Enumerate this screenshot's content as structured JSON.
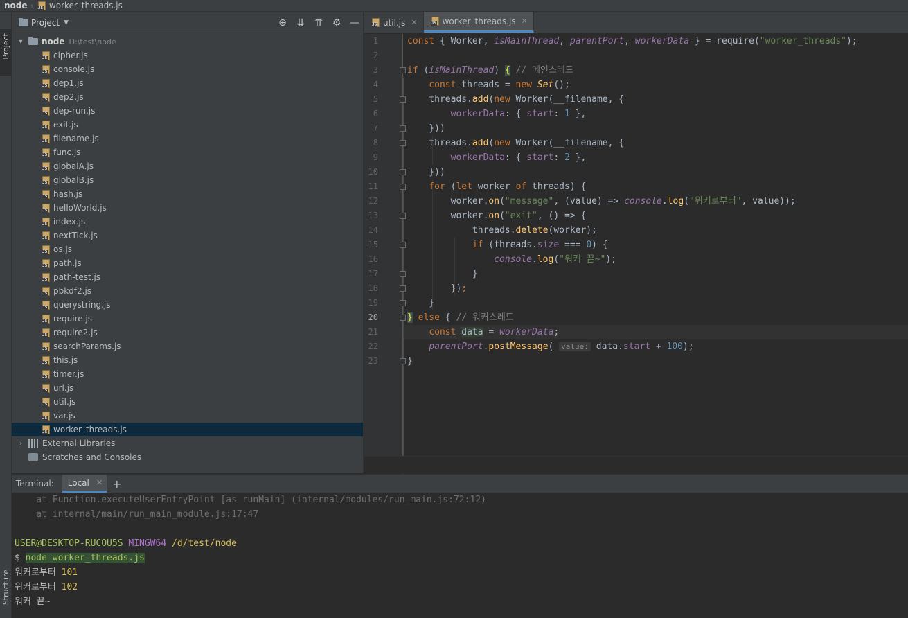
{
  "navbar": {
    "root": "node",
    "file": "worker_threads.js"
  },
  "left_stripe": {
    "project_label": "Project",
    "structure_label": "Structure"
  },
  "project_panel": {
    "title": "Project",
    "root": {
      "name": "node",
      "path": "D:\\test\\node"
    },
    "files": [
      "cipher.js",
      "console.js",
      "dep1.js",
      "dep2.js",
      "dep-run.js",
      "exit.js",
      "filename.js",
      "func.js",
      "globalA.js",
      "globalB.js",
      "hash.js",
      "helloWorld.js",
      "index.js",
      "nextTick.js",
      "os.js",
      "path.js",
      "path-test.js",
      "pbkdf2.js",
      "querystring.js",
      "require.js",
      "require2.js",
      "searchParams.js",
      "this.js",
      "timer.js",
      "url.js",
      "util.js",
      "var.js",
      "worker_threads.js"
    ],
    "selected_file": "worker_threads.js",
    "external_libraries": "External Libraries",
    "scratches": "Scratches and Consoles",
    "icons": [
      "locate-icon",
      "expand-all-icon",
      "collapse-all-icon",
      "gear-icon",
      "hide-icon"
    ]
  },
  "editor": {
    "tabs": [
      {
        "label": "util.js",
        "active": false
      },
      {
        "label": "worker_threads.js",
        "active": true
      }
    ],
    "caret_line": 20,
    "line_numbers": [
      "1",
      "2",
      "3",
      "4",
      "5",
      "6",
      "7",
      "8",
      "9",
      "10",
      "11",
      "12",
      "13",
      "14",
      "15",
      "16",
      "17",
      "18",
      "19",
      "20",
      "21",
      "22",
      "23"
    ],
    "strings": {
      "require_module": "\"worker_threads\"",
      "comment_main": "// 메인스레드",
      "comment_worker": "// 워커스레드",
      "message_event": "\"message\"",
      "exit_event": "\"exit\"",
      "log_from_worker": "\"워커로부터\"",
      "log_worker_done": "\"워커 끝~\"",
      "param_hint": "value:"
    },
    "numbers": {
      "start1": "1",
      "start2": "2",
      "zero": "0",
      "hundred": "100"
    }
  },
  "terminal": {
    "title": "Terminal:",
    "tab": "Local",
    "lines": {
      "trace1": "    at Function.executeUserEntryPoint [as runMain] (internal/modules/run_main.js:72:12)",
      "trace2": "    at internal/main/run_main_module.js:17:47",
      "user": "USER@DESKTOP-RUCOU5S",
      "shell": "MINGW64",
      "cwd": "/d/test/node",
      "prompt": "$",
      "command": "node worker_threads.js",
      "out1_label": "워커로부터",
      "out1_value": "101",
      "out2_label": "워커로부터",
      "out2_value": "102",
      "out3": "워커 끝~"
    }
  }
}
